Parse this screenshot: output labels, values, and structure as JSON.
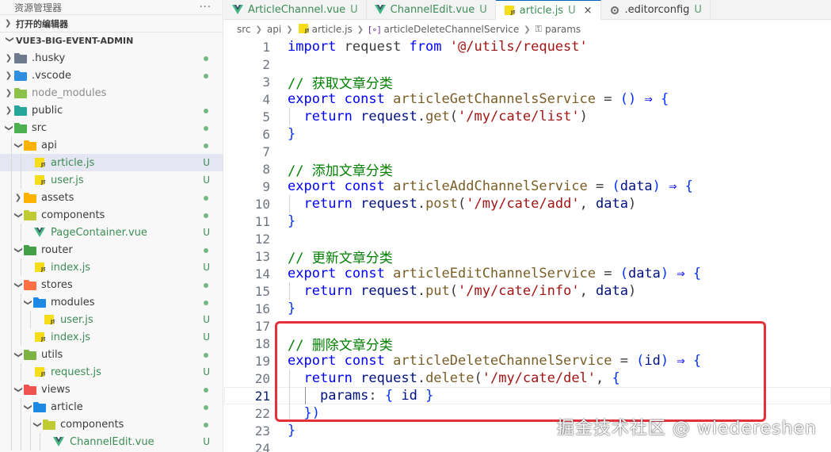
{
  "explorer": {
    "title": "资源管理器",
    "more": "···",
    "open_editors": "打开的编辑器",
    "project": "VUE3-BIG-EVENT-ADMIN",
    "items": [
      {
        "label": ".husky",
        "type": "folder",
        "depth": 1,
        "open": false,
        "status": "dot",
        "icon": "folder-husky-icon"
      },
      {
        "label": ".vscode",
        "type": "folder",
        "depth": 1,
        "open": false,
        "status": "dot",
        "icon": "folder-vscode-icon"
      },
      {
        "label": "node_modules",
        "type": "folder",
        "depth": 1,
        "open": false,
        "status": "",
        "icon": "folder-node-icon"
      },
      {
        "label": "public",
        "type": "folder",
        "depth": 1,
        "open": false,
        "status": "dot",
        "icon": "folder-public-icon"
      },
      {
        "label": "src",
        "type": "folder",
        "depth": 1,
        "open": true,
        "status": "dot",
        "icon": "folder-src-icon"
      },
      {
        "label": "api",
        "type": "folder",
        "depth": 2,
        "open": true,
        "status": "dot",
        "icon": "folder-api-icon"
      },
      {
        "label": "article.js",
        "type": "js",
        "depth": 3,
        "status": "U",
        "active": true,
        "icon": "js-file-icon"
      },
      {
        "label": "user.js",
        "type": "js",
        "depth": 3,
        "status": "U",
        "icon": "js-file-icon"
      },
      {
        "label": "assets",
        "type": "folder",
        "depth": 2,
        "open": false,
        "status": "dot",
        "icon": "folder-assets-icon"
      },
      {
        "label": "components",
        "type": "folder",
        "depth": 2,
        "open": true,
        "status": "dot",
        "icon": "folder-components-icon"
      },
      {
        "label": "PageContainer.vue",
        "type": "vue",
        "depth": 3,
        "status": "U",
        "icon": "vue-file-icon"
      },
      {
        "label": "router",
        "type": "folder",
        "depth": 2,
        "open": true,
        "status": "dot",
        "icon": "folder-router-icon"
      },
      {
        "label": "index.js",
        "type": "js",
        "depth": 3,
        "status": "U",
        "icon": "js-file-icon"
      },
      {
        "label": "stores",
        "type": "folder",
        "depth": 2,
        "open": true,
        "status": "dot",
        "icon": "folder-stores-icon"
      },
      {
        "label": "modules",
        "type": "folder",
        "depth": 3,
        "open": true,
        "status": "dot",
        "icon": "folder-modules-icon"
      },
      {
        "label": "user.js",
        "type": "js",
        "depth": 4,
        "status": "U",
        "icon": "js-file-icon"
      },
      {
        "label": "index.js",
        "type": "js",
        "depth": 3,
        "status": "U",
        "icon": "js-file-icon"
      },
      {
        "label": "utils",
        "type": "folder",
        "depth": 2,
        "open": true,
        "status": "dot",
        "icon": "folder-utils-icon"
      },
      {
        "label": "request.js",
        "type": "js",
        "depth": 3,
        "status": "U",
        "icon": "js-file-icon"
      },
      {
        "label": "views",
        "type": "folder",
        "depth": 2,
        "open": true,
        "status": "dot",
        "icon": "folder-views-icon"
      },
      {
        "label": "article",
        "type": "folder",
        "depth": 3,
        "open": true,
        "status": "dot",
        "icon": "folder-article-icon"
      },
      {
        "label": "components",
        "type": "folder",
        "depth": 4,
        "open": true,
        "status": "dot",
        "icon": "folder-components-icon"
      },
      {
        "label": "ChannelEdit.vue",
        "type": "vue",
        "depth": 5,
        "status": "U",
        "icon": "vue-file-icon"
      }
    ]
  },
  "tabs": [
    {
      "label": "ArticleChannel.vue",
      "status": "U",
      "type": "vue",
      "active": false,
      "icon": "vue-file-icon"
    },
    {
      "label": "ChannelEdit.vue",
      "status": "U",
      "type": "vue",
      "active": false,
      "icon": "vue-file-icon"
    },
    {
      "label": "article.js",
      "status": "U",
      "type": "js",
      "active": true,
      "close": "×",
      "icon": "js-file-icon"
    },
    {
      "label": ".editorconfig",
      "status": "U",
      "type": "config",
      "active": false,
      "icon": "gear-icon"
    }
  ],
  "breadcrumbs": [
    "src",
    "api",
    "article.js",
    "articleDeleteChannelService",
    "params"
  ],
  "editor": {
    "current_line": 21,
    "lines": [
      {
        "n": "1",
        "tokens": [
          [
            "kw",
            "import"
          ],
          [
            "pn",
            " request "
          ],
          [
            "kw",
            "from"
          ],
          [
            "pn",
            " "
          ],
          [
            "str",
            "'@/utils/request'"
          ]
        ]
      },
      {
        "n": "2",
        "tokens": []
      },
      {
        "n": "3",
        "tokens": [
          [
            "cm",
            "// 获取文章分类"
          ]
        ]
      },
      {
        "n": "4",
        "tokens": [
          [
            "kw",
            "export"
          ],
          [
            "pn",
            " "
          ],
          [
            "kw",
            "const"
          ],
          [
            "pn",
            " "
          ],
          [
            "fn",
            "articleGetChannelsService"
          ],
          [
            "pn",
            " = "
          ],
          [
            "br",
            "()"
          ],
          [
            "pn",
            " "
          ],
          [
            "kw",
            "⇒"
          ],
          [
            "pn",
            " "
          ],
          [
            "br",
            "{"
          ]
        ]
      },
      {
        "n": "5",
        "tokens": [
          [
            "pn",
            "  "
          ],
          [
            "kw",
            "return"
          ],
          [
            "pn",
            " "
          ],
          [
            "vr",
            "request"
          ],
          [
            "pn",
            "."
          ],
          [
            "fn",
            "get"
          ],
          [
            "pn",
            "("
          ],
          [
            "str",
            "'/my/cate/list'"
          ],
          [
            "pn",
            ")"
          ]
        ]
      },
      {
        "n": "6",
        "tokens": [
          [
            "br",
            "}"
          ]
        ]
      },
      {
        "n": "7",
        "tokens": []
      },
      {
        "n": "8",
        "tokens": [
          [
            "cm",
            "// 添加文章分类"
          ]
        ]
      },
      {
        "n": "9",
        "tokens": [
          [
            "kw",
            "export"
          ],
          [
            "pn",
            " "
          ],
          [
            "kw",
            "const"
          ],
          [
            "pn",
            " "
          ],
          [
            "fn",
            "articleAddChannelService"
          ],
          [
            "pn",
            " = "
          ],
          [
            "br",
            "("
          ],
          [
            "vr",
            "data"
          ],
          [
            "br",
            ")"
          ],
          [
            "pn",
            " "
          ],
          [
            "kw",
            "⇒"
          ],
          [
            "pn",
            " "
          ],
          [
            "br",
            "{"
          ]
        ]
      },
      {
        "n": "10",
        "tokens": [
          [
            "pn",
            "  "
          ],
          [
            "kw",
            "return"
          ],
          [
            "pn",
            " "
          ],
          [
            "vr",
            "request"
          ],
          [
            "pn",
            "."
          ],
          [
            "fn",
            "post"
          ],
          [
            "pn",
            "("
          ],
          [
            "str",
            "'/my/cate/add'"
          ],
          [
            "pn",
            ", "
          ],
          [
            "vr",
            "data"
          ],
          [
            "pn",
            ")"
          ]
        ]
      },
      {
        "n": "11",
        "tokens": [
          [
            "br",
            "}"
          ]
        ]
      },
      {
        "n": "12",
        "tokens": []
      },
      {
        "n": "13",
        "tokens": [
          [
            "cm",
            "// 更新文章分类"
          ]
        ]
      },
      {
        "n": "14",
        "tokens": [
          [
            "kw",
            "export"
          ],
          [
            "pn",
            " "
          ],
          [
            "kw",
            "const"
          ],
          [
            "pn",
            " "
          ],
          [
            "fn",
            "articleEditChannelService"
          ],
          [
            "pn",
            " = "
          ],
          [
            "br",
            "("
          ],
          [
            "vr",
            "data"
          ],
          [
            "br",
            ")"
          ],
          [
            "pn",
            " "
          ],
          [
            "kw",
            "⇒"
          ],
          [
            "pn",
            " "
          ],
          [
            "br",
            "{"
          ]
        ]
      },
      {
        "n": "15",
        "tokens": [
          [
            "pn",
            "  "
          ],
          [
            "kw",
            "return"
          ],
          [
            "pn",
            " "
          ],
          [
            "vr",
            "request"
          ],
          [
            "pn",
            "."
          ],
          [
            "fn",
            "put"
          ],
          [
            "pn",
            "("
          ],
          [
            "str",
            "'/my/cate/info'"
          ],
          [
            "pn",
            ", "
          ],
          [
            "vr",
            "data"
          ],
          [
            "pn",
            ")"
          ]
        ]
      },
      {
        "n": "16",
        "tokens": [
          [
            "br",
            "}"
          ]
        ]
      },
      {
        "n": "17",
        "tokens": []
      },
      {
        "n": "18",
        "tokens": [
          [
            "cm",
            "// 删除文章分类"
          ]
        ]
      },
      {
        "n": "19",
        "tokens": [
          [
            "kw",
            "export"
          ],
          [
            "pn",
            " "
          ],
          [
            "kw",
            "const"
          ],
          [
            "pn",
            " "
          ],
          [
            "fn",
            "articleDeleteChannelService"
          ],
          [
            "pn",
            " = "
          ],
          [
            "br",
            "("
          ],
          [
            "vr",
            "id"
          ],
          [
            "br",
            ")"
          ],
          [
            "pn",
            " "
          ],
          [
            "kw",
            "⇒"
          ],
          [
            "pn",
            " "
          ],
          [
            "br",
            "{"
          ]
        ]
      },
      {
        "n": "20",
        "tokens": [
          [
            "pn",
            "  "
          ],
          [
            "kw",
            "return"
          ],
          [
            "pn",
            " "
          ],
          [
            "vr",
            "request"
          ],
          [
            "pn",
            "."
          ],
          [
            "fn",
            "delete"
          ],
          [
            "pn",
            "("
          ],
          [
            "str",
            "'/my/cate/del'"
          ],
          [
            "pn",
            ", "
          ],
          [
            "br",
            "{"
          ]
        ]
      },
      {
        "n": "21",
        "tokens": [
          [
            "pn",
            "    "
          ],
          [
            "vr",
            "params"
          ],
          [
            "pn",
            ": "
          ],
          [
            "br",
            "{"
          ],
          [
            "pn",
            " "
          ],
          [
            "vr",
            "id"
          ],
          [
            "pn",
            " "
          ],
          [
            "br",
            "}"
          ]
        ]
      },
      {
        "n": "22",
        "tokens": [
          [
            "pn",
            "  "
          ],
          [
            "br",
            "})"
          ]
        ]
      },
      {
        "n": "23",
        "tokens": [
          [
            "br",
            "}"
          ]
        ]
      },
      {
        "n": "24",
        "tokens": []
      }
    ]
  },
  "watermark": "掘金技术社区 @ wiedereshen",
  "colors": {
    "accent": "#005fb8",
    "untracked": "#5a9e6f",
    "highlight_box": "#e5303a",
    "keyword": "#0000ff",
    "function": "#795e26",
    "string": "#a31515",
    "comment": "#008000"
  }
}
